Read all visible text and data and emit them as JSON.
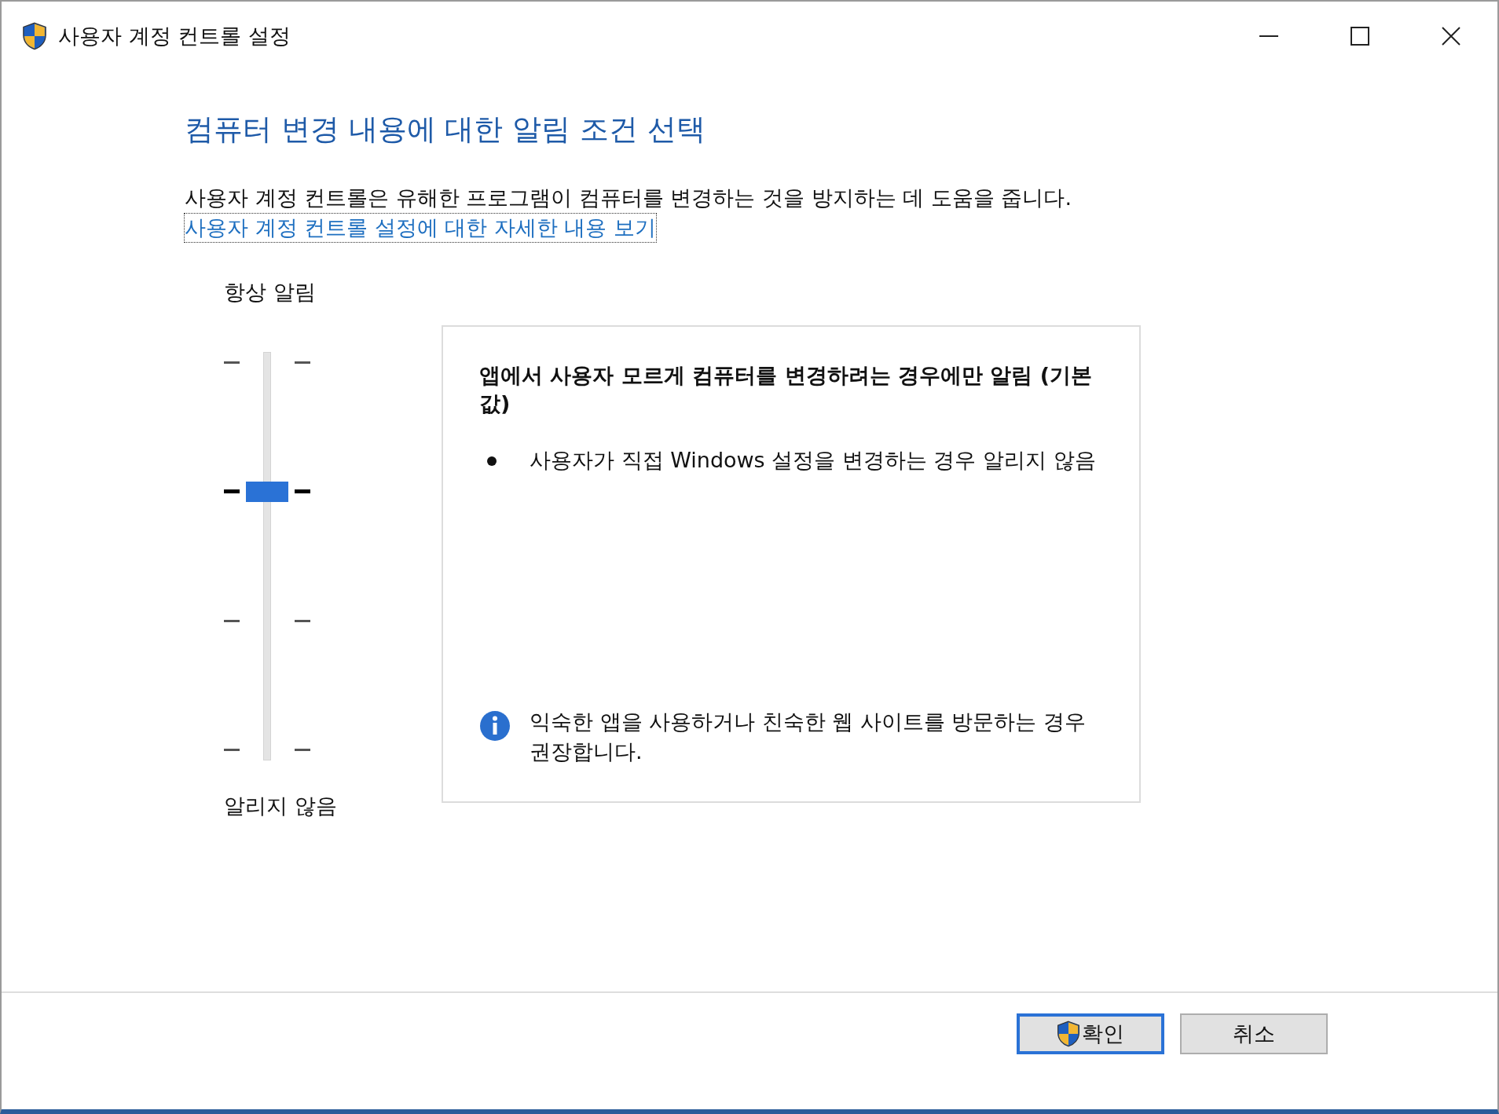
{
  "window": {
    "title": "사용자 계정 컨트롤 설정"
  },
  "heading": "컴퓨터 변경 내용에 대한 알림 조건 선택",
  "description": "사용자 계정 컨트롤은 유해한 프로그램이 컴퓨터를 변경하는 것을 방지하는 데 도움을 줍니다.",
  "link": "사용자 계정 컨트롤 설정에 대한 자세한 내용 보기",
  "slider": {
    "top_label": "항상 알림",
    "bottom_label": "알리지 않음",
    "stops": [
      {
        "selected": false
      },
      {
        "selected": true
      },
      {
        "selected": false
      },
      {
        "selected": false
      }
    ]
  },
  "info_box": {
    "title": "앱에서 사용자 모르게 컴퓨터를 변경하려는 경우에만 알림 (기본값)",
    "bullets": [
      "사용자가 직접 Windows 설정을 변경하는 경우 알리지 않음"
    ],
    "note": "익숙한 앱을 사용하거나 친숙한 웹 사이트를 방문하는 경우 권장합니다."
  },
  "buttons": [
    {
      "label": "확인",
      "kind": "shield",
      "default": true
    },
    {
      "label": "취소",
      "kind": "plain",
      "default": false
    }
  ]
}
